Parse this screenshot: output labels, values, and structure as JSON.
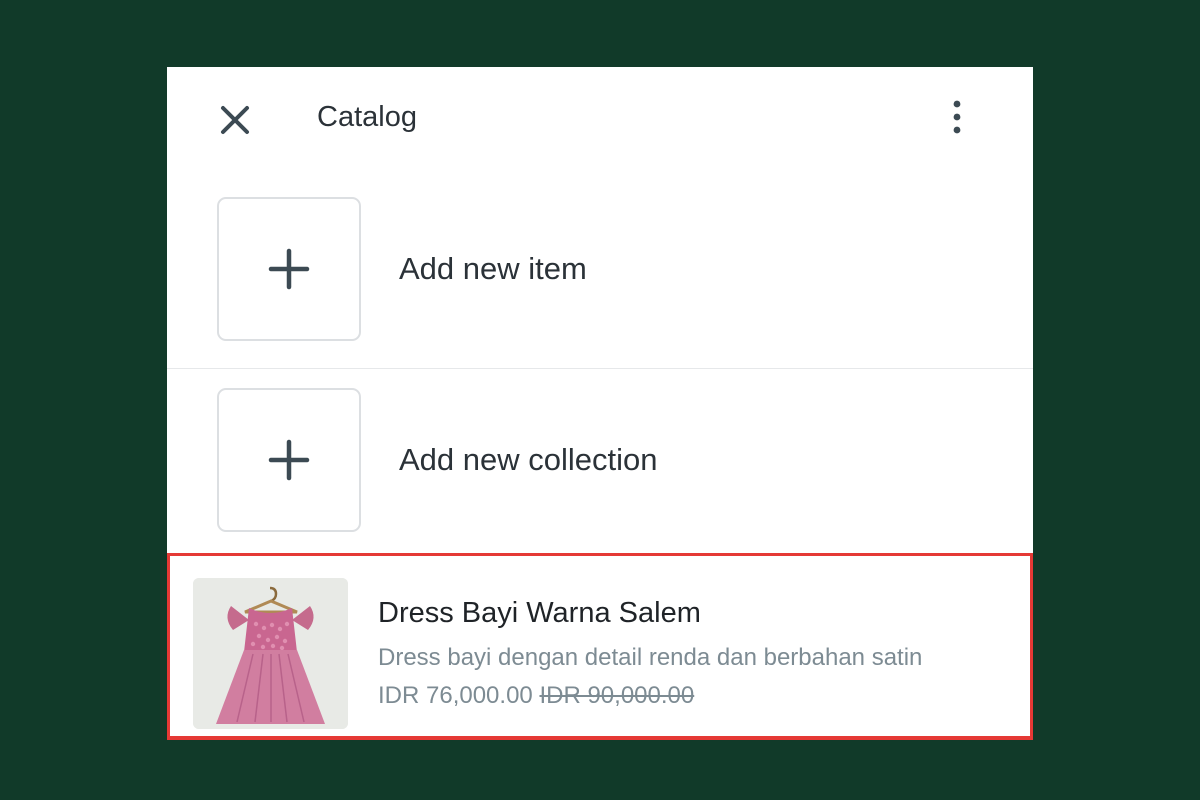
{
  "header": {
    "title": "Catalog",
    "close_icon": "close-icon",
    "menu_icon": "more-vertical-icon"
  },
  "actions": [
    {
      "label": "Add new item",
      "icon": "plus-icon"
    },
    {
      "label": "Add new collection",
      "icon": "plus-icon"
    }
  ],
  "product": {
    "name": "Dress Bayi Warna Salem",
    "description": "Dress bayi dengan detail renda dan berbahan satin",
    "price": "IDR 76,000.00",
    "original_price": "IDR 90,000.00",
    "highlight_color": "#e53935"
  },
  "colors": {
    "background": "#113a29",
    "panel": "#ffffff",
    "icon": "#3c4a53",
    "text_secondary": "#7d8b93"
  }
}
